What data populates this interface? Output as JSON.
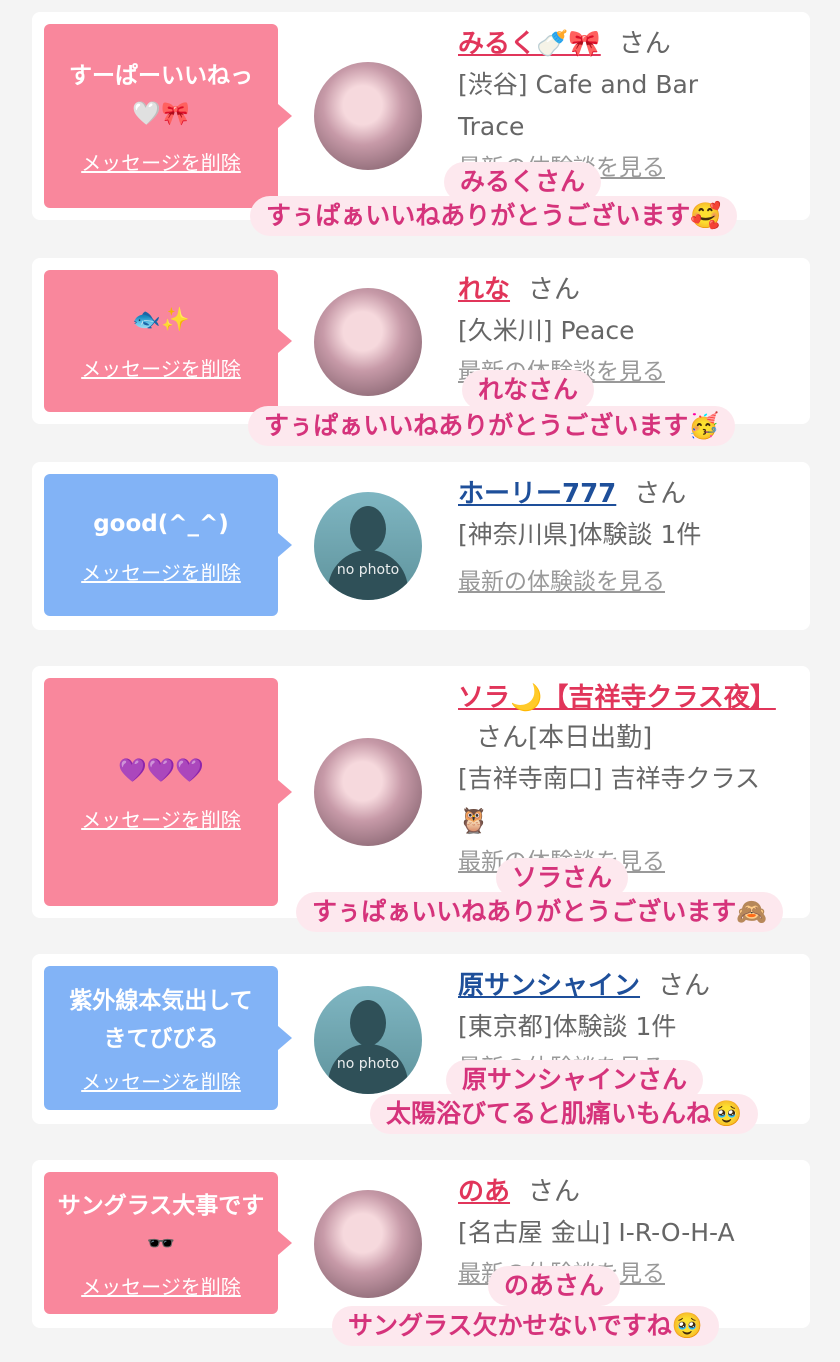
{
  "cards": [
    {
      "msg": "すーぱーいいねっ🤍🎀",
      "delete": "メッセージを削除",
      "name": "みるく🍼🎀",
      "san": "さん",
      "shop": "[渋谷] Cafe and Bar Trace",
      "more": "最新の体験談を見る"
    },
    {
      "msg": "🐟✨",
      "delete": "メッセージを削除",
      "name": "れな",
      "san": "さん",
      "shop": "[久米川] Peace",
      "more": "最新の体験談を見る"
    },
    {
      "msg": "good(^_^)",
      "delete": "メッセージを削除",
      "name": "ホーリー777",
      "san": "さん",
      "shop": "[神奈川県]体験談 1件",
      "more": "最新の体験談を見る",
      "photo": "no photo"
    },
    {
      "msg": "💜💜💜",
      "delete": "メッセージを削除",
      "name": "ソラ🌙【吉祥寺クラス夜】",
      "san": "さん[本日出勤]",
      "shop": "[吉祥寺南口] 吉祥寺クラス🦉",
      "more": "最新の体験談を見る"
    },
    {
      "msg": "紫外線本気出してきてびびる",
      "delete": "メッセージを削除",
      "name": "原サンシャイン",
      "san": "さん",
      "shop": "[東京都]体験談 1件",
      "more": "最新の体験談を見る",
      "photo": "no photo"
    },
    {
      "msg": "サングラス大事です🕶️",
      "delete": "メッセージを削除",
      "name": "のあ",
      "san": "さん",
      "shop": "[名古屋 金山] I-R-O-H-A",
      "more": "最新の体験談を見る"
    }
  ],
  "captions": [
    {
      "who": "みるくさん",
      "text": "すぅぱぁいいねありがとうございます🥰"
    },
    {
      "who": "れなさん",
      "text": "すぅぱぁいいねありがとうございます🥳"
    },
    {
      "who": "ソラさん",
      "text": "すぅぱぁいいねありがとうございます🙈"
    },
    {
      "who": "原サンシャインさん",
      "text": "太陽浴びてると肌痛いもんね🥹"
    },
    {
      "who": "のあさん",
      "text": "サングラス欠かせないですね🥹"
    }
  ]
}
